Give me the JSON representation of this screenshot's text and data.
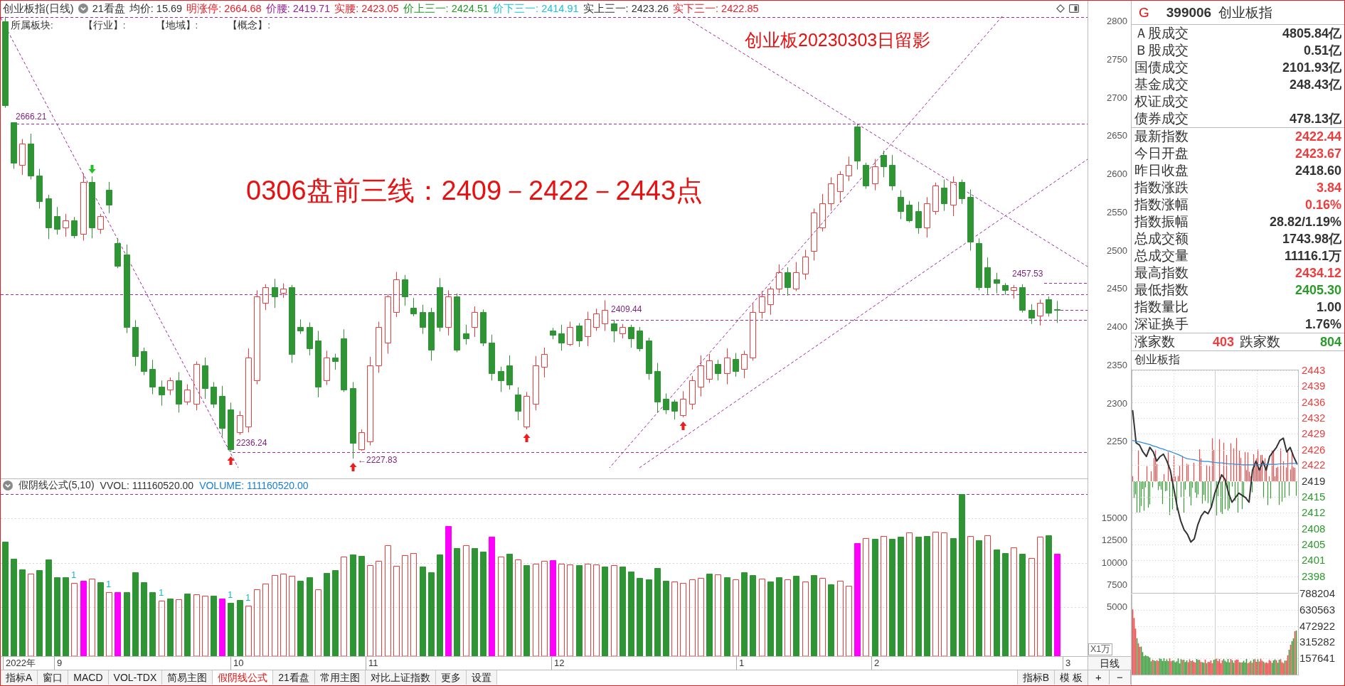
{
  "header": {
    "title": "创业板指(日线)",
    "view": "21看盘",
    "stats": [
      {
        "text": "均价: 15.69",
        "color": "#333333"
      },
      {
        "text": "明涨停: 2664.68",
        "color": "#e8202a"
      },
      {
        "text": "价腰: 2419.71",
        "color": "#9b1f9b"
      },
      {
        "text": "实腰: 2423.05",
        "color": "#e8202a"
      },
      {
        "text": "价上三一: 2424.51",
        "color": "#1f9a1f"
      },
      {
        "text": "价下三一: 2414.91",
        "color": "#19c3d6"
      },
      {
        "text": "实上三一: 2423.26",
        "color": "#333333"
      },
      {
        "text": "实下三一: 2422.85",
        "color": "#e8202a"
      }
    ]
  },
  "kline_chart": {
    "sector_labels": [
      "所属板块:",
      "【行业】:",
      "【地域】:",
      "【概念】:"
    ],
    "caption": "创业板20230303日留影",
    "note": "0306盘前三线：2409－2422－2443点",
    "annotations": [
      "2666.21",
      "2236.24",
      "←2227.83",
      "2409.44",
      "2457.53"
    ],
    "price_axis": [
      "2800",
      "2750",
      "2700",
      "2650",
      "2600",
      "2550",
      "2500",
      "2450",
      "2400",
      "2350",
      "2300",
      "2250"
    ]
  },
  "volume_panel": {
    "legend": [
      {
        "text": "假阴线公式(5,10)",
        "color": "#333333"
      },
      {
        "text": "VVOL: 111160520.00",
        "color": "#333333"
      },
      {
        "text": "VOLUME: 111160520.00",
        "color": "#1a7fd4"
      }
    ],
    "markers": [
      "1",
      "1",
      "1",
      "1",
      "1"
    ],
    "volume_axis": [
      "15000",
      "12500",
      "10000",
      "7500",
      "5000"
    ],
    "unit": "X1万"
  },
  "time_axis": [
    "2022年",
    "9",
    "10",
    "11",
    "12",
    "1",
    "2",
    "3"
  ],
  "bottom_bar": {
    "tabs": [
      {
        "label": "指标A",
        "selected": false
      },
      {
        "label": "窗口",
        "selected": false
      },
      {
        "label": "MACD",
        "selected": false
      },
      {
        "label": "VOL-TDX",
        "selected": false
      },
      {
        "label": "简易主图",
        "selected": false
      },
      {
        "label": "假阴线公式",
        "selected": true
      },
      {
        "label": "21看盘",
        "selected": false
      },
      {
        "label": "常用主图",
        "selected": false
      },
      {
        "label": "对比上证指数",
        "selected": false
      },
      {
        "label": "更多",
        "selected": false
      },
      {
        "label": "设置",
        "selected": false
      }
    ],
    "right_tabs": [
      "指标B",
      "模 板"
    ],
    "period": "日线",
    "zoom_buttons": [
      "+",
      "−"
    ]
  },
  "quote_panel": {
    "marker": "G",
    "code": "399006",
    "name": "创业板指",
    "turnover_rows": [
      {
        "label": "Ａ股成交",
        "value": "4805.84亿"
      },
      {
        "label": "Ｂ股成交",
        "value": "0.51亿"
      },
      {
        "label": "国债成交",
        "value": "2101.93亿"
      },
      {
        "label": "基金成交",
        "value": "248.43亿"
      },
      {
        "label": "权证成交"
      },
      {
        "label": "债券成交",
        "value": "478.13亿"
      }
    ],
    "index_rows": [
      {
        "label": "最新指数",
        "value": "2422.44",
        "color": "#f03c3c"
      },
      {
        "label": "今日开盘",
        "value": "2423.67",
        "color": "#f03c3c"
      },
      {
        "label": "昨日收盘",
        "value": "2418.60",
        "color": "#333333"
      },
      {
        "label": "指数涨跌",
        "value": "3.84",
        "color": "#f03c3c"
      },
      {
        "label": "指数涨幅",
        "value": "0.16%",
        "color": "#f03c3c"
      },
      {
        "label": "指数振幅",
        "value": "28.82/1.19%",
        "color": "#333333"
      },
      {
        "label": "总成交额",
        "value": "1743.98亿",
        "color": "#333333"
      },
      {
        "label": "总成交量",
        "value": "11116.1万",
        "color": "#333333"
      },
      {
        "label": "最高指数",
        "value": "2434.12",
        "color": "#f03c3c"
      },
      {
        "label": "最低指数",
        "value": "2405.30",
        "color": "#2a9a2a"
      },
      {
        "label": "指数量比",
        "value": "1.00",
        "color": "#333333"
      },
      {
        "label": "深证换手",
        "value": "1.76%",
        "color": "#333333"
      }
    ],
    "breadth": {
      "up_label": "涨家数",
      "up_count": "403",
      "down_label": "跌家数",
      "down_count": "804"
    }
  },
  "intraday_chart": {
    "title": "创业板指",
    "chart_data": {
      "type": "line",
      "ylim": [
        2394.2,
        2442.9
      ],
      "grid": true,
      "yticks": [
        {
          "value": 2442.8,
          "label": "2443"
        },
        {
          "value": 2439.4,
          "label": "2439"
        },
        {
          "value": 2435.9,
          "label": "2436"
        },
        {
          "value": 2432.4,
          "label": "2432"
        },
        {
          "value": 2429.0,
          "label": "2429"
        },
        {
          "value": 2425.5,
          "label": "2426"
        },
        {
          "value": 2422.1,
          "label": "2422"
        },
        {
          "value": 2418.6,
          "label": "2419"
        },
        {
          "value": 2415.1,
          "label": "2415"
        },
        {
          "value": 2411.7,
          "label": "2412"
        },
        {
          "value": 2408.2,
          "label": "2408"
        },
        {
          "value": 2404.8,
          "label": "2405"
        },
        {
          "value": 2401.3,
          "label": "2401"
        },
        {
          "value": 2397.8,
          "label": "2398"
        }
      ],
      "series": [
        {
          "color": "#333333",
          "values": [
            2434,
            2427,
            2426.5,
            2425,
            2424,
            2426,
            2425,
            2423,
            2424,
            2424.5,
            2423,
            2421,
            2417,
            2413,
            2410,
            2408,
            2407,
            2405.3,
            2406,
            2409,
            2411,
            2412,
            2411.5,
            2413,
            2416,
            2418,
            2420,
            2419,
            2416,
            2414,
            2415,
            2416,
            2415.5,
            2415,
            2414,
            2421,
            2423,
            2421,
            2423,
            2421,
            2424,
            2425,
            2426,
            2427.5,
            2428,
            2425,
            2426,
            2424,
            2422.4
          ]
        },
        {
          "color": "#2a8ce0",
          "values": [
            2427.5,
            2427.3,
            2427.2,
            2427.0,
            2426.8,
            2426.6,
            2426.3,
            2426.1,
            2425.8,
            2425.6,
            2425.3,
            2425.1,
            2424.8,
            2424.5,
            2424.2,
            2423.8,
            2423.5,
            2423.4,
            2423.3,
            2423.1,
            2423.0,
            2422.9,
            2422.9,
            2422.8,
            2422.7,
            2422.6,
            2422.6,
            2422.5,
            2422.4,
            2422.4,
            2422.3,
            2422.3,
            2422.2,
            2422.2,
            2422.2,
            2422.2,
            2422.2,
            2422.2,
            2422.2,
            2422.3,
            2422.3,
            2422.3,
            2422.3,
            2422.4,
            2422.4,
            2422.4,
            2422.5,
            2422.5,
            2422.5
          ]
        }
      ]
    },
    "volume_labels": [
      "788204",
      "630563",
      "472922",
      "315282",
      "157641"
    ]
  }
}
